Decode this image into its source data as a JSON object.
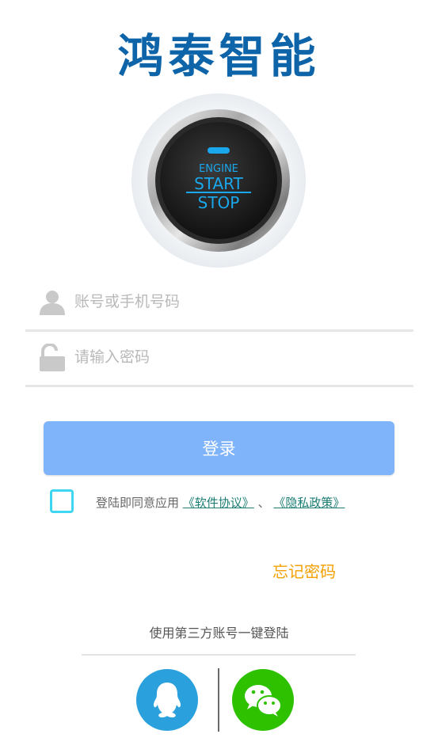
{
  "brand": {
    "logo_text": "鸿泰智能",
    "logo_color": "#0e64a8"
  },
  "engine_button": {
    "line1": "ENGINE",
    "line2": "START",
    "line3": "STOP",
    "text_color": "#1aa7ec"
  },
  "form": {
    "account_placeholder": "账号或手机号码",
    "password_placeholder": "请输入密码",
    "account_value": "",
    "password_value": ""
  },
  "login": {
    "button_label": "登录",
    "button_color": "#7fb4fb"
  },
  "agreement": {
    "checked": false,
    "prefix": "登陆即同意应用",
    "terms_link": "《软件协议》",
    "separator": "、",
    "privacy_link": "《隐私政策》",
    "checkbox_color": "#3fd6f2",
    "link_color": "#1b7d73"
  },
  "forgot": {
    "label": "忘记密码",
    "color": "#f3a000"
  },
  "third_party": {
    "title": "使用第三方账号一键登陆",
    "providers": [
      {
        "icon": "qq-icon",
        "color": "#2aa0dd"
      },
      {
        "icon": "wechat-icon",
        "color": "#2dc100"
      }
    ]
  }
}
